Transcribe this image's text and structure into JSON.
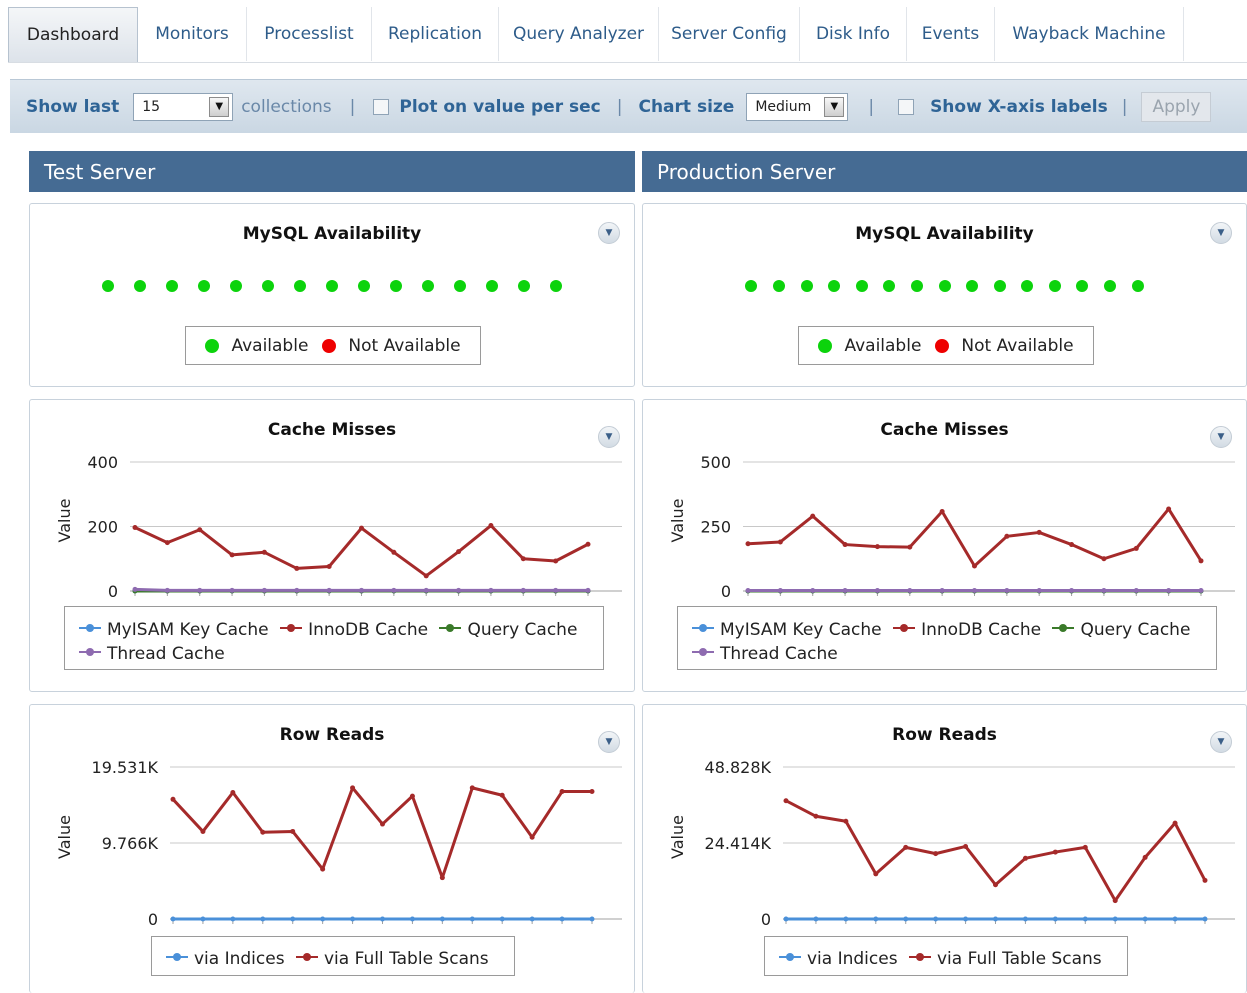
{
  "tabs": [
    "Dashboard",
    "Monitors",
    "Processlist",
    "Replication",
    "Query Analyzer",
    "Server Config",
    "Disk Info",
    "Events",
    "Wayback Machine"
  ],
  "toolbar": {
    "show_last": "Show last",
    "collections_value": "15",
    "collections": "collections",
    "plot_per_sec": "Plot on value per sec",
    "chart_size_label": "Chart size",
    "chart_size_value": "Medium",
    "show_x_labels": "Show X-axis labels",
    "apply": "Apply",
    "separator": "|"
  },
  "servers": [
    {
      "name": "Test Server",
      "availability": {
        "title": "MySQL Availability",
        "count": 15,
        "legend": [
          "Available",
          "Not Available"
        ]
      },
      "cache": {
        "title": "Cache Misses",
        "ylabel": "Value",
        "ticks": [
          "400",
          "200",
          "0"
        ],
        "legend": [
          "MyISAM Key Cache",
          "InnoDB Cache",
          "Query Cache",
          "Thread Cache"
        ]
      },
      "rows": {
        "title": "Row Reads",
        "ylabel": "Value",
        "ticks": [
          "19.531K",
          "9.766K",
          "0"
        ],
        "legend": [
          "via Indices",
          "via Full Table Scans"
        ]
      }
    },
    {
      "name": "Production Server",
      "availability": {
        "title": "MySQL Availability",
        "count": 15,
        "legend": [
          "Available",
          "Not Available"
        ]
      },
      "cache": {
        "title": "Cache Misses",
        "ylabel": "Value",
        "ticks": [
          "500",
          "250",
          "0"
        ],
        "legend": [
          "MyISAM Key Cache",
          "InnoDB Cache",
          "Query Cache",
          "Thread Cache"
        ]
      },
      "rows": {
        "title": "Row Reads",
        "ylabel": "Value",
        "ticks": [
          "48.828K",
          "24.414K",
          "0"
        ],
        "legend": [
          "via Indices",
          "via Full Table Scans"
        ]
      }
    }
  ],
  "colors": {
    "available": "#0cd30c",
    "not_available": "#ee0000",
    "myisam": "#4a90d9",
    "innodb": "#a52a2a",
    "query": "#3a7a2a",
    "thread": "#8e6bb0",
    "header_bg": "#456b93"
  },
  "chart_data": [
    {
      "type": "line",
      "title": "Cache Misses",
      "panel": "Test Server",
      "ylabel": "Value",
      "ylim": [
        0,
        400
      ],
      "x": [
        1,
        2,
        3,
        4,
        5,
        6,
        7,
        8,
        9,
        10,
        11,
        12,
        13,
        14,
        15
      ],
      "series": [
        {
          "name": "MyISAM Key Cache",
          "values": [
            0,
            0,
            0,
            0,
            0,
            0,
            0,
            0,
            0,
            0,
            0,
            0,
            0,
            0,
            0
          ]
        },
        {
          "name": "InnoDB Cache",
          "values": [
            197,
            150,
            190,
            112,
            120,
            70,
            76,
            195,
            120,
            47,
            122,
            203,
            100,
            93,
            145
          ]
        },
        {
          "name": "Query Cache",
          "values": [
            0,
            0,
            0,
            0,
            0,
            0,
            0,
            0,
            0,
            0,
            0,
            0,
            0,
            0,
            0
          ]
        },
        {
          "name": "Thread Cache",
          "values": [
            5,
            2,
            2,
            2,
            2,
            2,
            2,
            2,
            2,
            2,
            2,
            2,
            2,
            2,
            2
          ]
        }
      ]
    },
    {
      "type": "line",
      "title": "Row Reads",
      "panel": "Test Server",
      "ylabel": "Value",
      "ylim": [
        0,
        19531
      ],
      "x": [
        1,
        2,
        3,
        4,
        5,
        6,
        7,
        8,
        9,
        10,
        11,
        12,
        13,
        14,
        15
      ],
      "series": [
        {
          "name": "via Indices",
          "values": [
            0,
            0,
            0,
            0,
            0,
            0,
            0,
            0,
            0,
            0,
            0,
            0,
            0,
            0,
            0
          ]
        },
        {
          "name": "via Full Table Scans",
          "values": [
            15380,
            11250,
            16250,
            11150,
            11250,
            6410,
            16850,
            12200,
            15790,
            5310,
            16850,
            15900,
            10500,
            16380,
            16380
          ]
        }
      ]
    },
    {
      "type": "line",
      "title": "Cache Misses",
      "panel": "Production Server",
      "ylabel": "Value",
      "ylim": [
        0,
        500
      ],
      "x": [
        1,
        2,
        3,
        4,
        5,
        6,
        7,
        8,
        9,
        10,
        11,
        12,
        13,
        14,
        15
      ],
      "series": [
        {
          "name": "MyISAM Key Cache",
          "values": [
            0,
            0,
            0,
            0,
            0,
            0,
            0,
            0,
            0,
            0,
            0,
            0,
            0,
            0,
            0
          ]
        },
        {
          "name": "InnoDB Cache",
          "values": [
            183,
            190,
            290,
            180,
            172,
            170,
            308,
            97,
            212,
            227,
            180,
            125,
            165,
            318,
            117
          ]
        },
        {
          "name": "Query Cache",
          "values": [
            0,
            0,
            0,
            0,
            0,
            0,
            0,
            0,
            0,
            0,
            0,
            0,
            0,
            0,
            0
          ]
        },
        {
          "name": "Thread Cache",
          "values": [
            2,
            2,
            2,
            2,
            2,
            2,
            2,
            2,
            2,
            2,
            2,
            2,
            2,
            2,
            2
          ]
        }
      ]
    },
    {
      "type": "line",
      "title": "Row Reads",
      "panel": "Production Server",
      "ylabel": "Value",
      "ylim": [
        0,
        48828
      ],
      "x": [
        1,
        2,
        3,
        4,
        5,
        6,
        7,
        8,
        9,
        10,
        11,
        12,
        13,
        14,
        15
      ],
      "series": [
        {
          "name": "via Indices",
          "values": [
            0,
            0,
            0,
            0,
            0,
            0,
            0,
            0,
            0,
            0,
            0,
            0,
            0,
            0,
            0
          ]
        },
        {
          "name": "via Full Table Scans",
          "values": [
            38000,
            33000,
            31400,
            14500,
            23000,
            21000,
            23300,
            11000,
            19500,
            21500,
            23000,
            5900,
            19800,
            30800,
            12400
          ]
        }
      ]
    }
  ]
}
